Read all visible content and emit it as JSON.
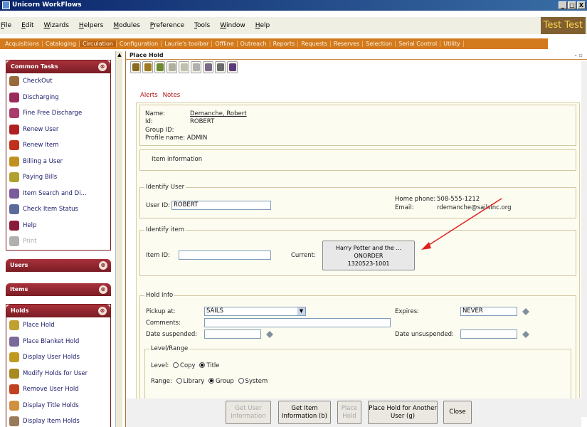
{
  "window": {
    "title": "Unicorn WorkFlows",
    "controls": [
      "_",
      "□",
      "X"
    ]
  },
  "menubar": {
    "items": [
      "File",
      "Edit",
      "Wizards",
      "Helpers",
      "Modules",
      "Preference",
      "Tools",
      "Window",
      "Help"
    ],
    "user_label": "Test Test"
  },
  "modules": [
    "Acquisitions",
    "Cataloging",
    "Circulation",
    "Configuration",
    "Laurie's toolbar",
    "Offline",
    "Outreach",
    "Reports",
    "Requests",
    "Reserves",
    "Selection",
    "Serial Control",
    "Utility"
  ],
  "left_panel": {
    "common_tasks": {
      "title": "Common Tasks",
      "items": [
        {
          "label": "CheckOut",
          "icon": "checkout-icon",
          "color": "#9a6b3a"
        },
        {
          "label": "Discharging",
          "icon": "discharge-icon",
          "color": "#9b2b5a"
        },
        {
          "label": "Fine Free Discharge",
          "icon": "fine-free-icon",
          "color": "#a83c6c"
        },
        {
          "label": "Renew User",
          "icon": "renew-user-icon",
          "color": "#b02020"
        },
        {
          "label": "Renew Item",
          "icon": "renew-item-icon",
          "color": "#c0301a"
        },
        {
          "label": "Billing a User",
          "icon": "billing-icon",
          "color": "#c09020"
        },
        {
          "label": "Paying Bills",
          "icon": "paying-bills-icon",
          "color": "#b0a030"
        },
        {
          "label": "Item Search and Di...",
          "icon": "item-search-icon",
          "color": "#7a5a9a"
        },
        {
          "label": "Check Item Status",
          "icon": "item-status-icon",
          "color": "#5a6a9a"
        },
        {
          "label": "Help",
          "icon": "help-icon",
          "color": "#8a1c3a"
        },
        {
          "label": "Print",
          "icon": "print-icon",
          "color": "#b0b0b0"
        }
      ]
    },
    "users": {
      "title": "Users"
    },
    "items": {
      "title": "Items"
    },
    "holds": {
      "title": "Holds",
      "items": [
        {
          "label": "Place Hold",
          "icon": "place-hold-icon",
          "color": "#c0a030"
        },
        {
          "label": "Place Blanket Hold",
          "icon": "blanket-hold-icon",
          "color": "#7a6a9a"
        },
        {
          "label": "Display User Holds",
          "icon": "display-user-holds-icon",
          "color": "#c09a20"
        },
        {
          "label": "Modify Holds for User",
          "icon": "modify-holds-icon",
          "color": "#a88a20"
        },
        {
          "label": "Remove User Hold",
          "icon": "remove-hold-icon",
          "color": "#c04020"
        },
        {
          "label": "Display Title Holds",
          "icon": "title-holds-icon",
          "color": "#d09040"
        },
        {
          "label": "Display Item Holds",
          "icon": "item-holds-icon",
          "color": "#9a7a5a"
        }
      ]
    },
    "collapse_glyph": "⊗"
  },
  "main": {
    "title": "Place Hold",
    "window_controls": "- ▫",
    "toolbar_icons": [
      {
        "name": "user-search-icon",
        "color": "#8a6a20"
      },
      {
        "name": "user-info-icon",
        "color": "#a07a20"
      },
      {
        "name": "display-user-icon",
        "color": "#6a8a30"
      },
      {
        "name": "item-info-icon",
        "color": "#b0b0a0"
      },
      {
        "name": "place-hold-tool-icon",
        "color": "#c0c0b0"
      },
      {
        "name": "hold-list-icon",
        "color": "#b0b0b0"
      },
      {
        "name": "modify-icon",
        "color": "#7a6a8a"
      },
      {
        "name": "search-item-icon",
        "color": "#6a6a6a"
      },
      {
        "name": "barcode-icon",
        "color": "#5a3a7a"
      }
    ],
    "tabs": [
      "Alerts",
      "Notes"
    ],
    "user_info": {
      "name_label": "Name:",
      "name_value": "Demanche, Robert",
      "id_label": "Id:",
      "id_value": "ROBERT",
      "group_label": "Group ID:",
      "profile_label": "Profile name: ADMIN"
    },
    "item_information_label": "Item information",
    "identify_user": {
      "title": "Identify User",
      "user_id_label": "User ID:",
      "user_id_value": "ROBERT",
      "home_phone_label": "Home phone:",
      "home_phone_value": "508-555-1212",
      "email_label": "Email:",
      "email_value": "rdemanche@sailsinc.org"
    },
    "identify_item": {
      "title": "Identify item",
      "item_id_label": "Item ID:",
      "item_id_value": "",
      "current_label": "Current:",
      "current_line1": "Harry Potter and the ...",
      "current_line2": "ONORDER",
      "current_line3": "1320523-1001"
    },
    "hold_info": {
      "title": "Hold Info",
      "pickup_label": "Pickup at:",
      "pickup_value": "SAILS",
      "expires_label": "Expires:",
      "expires_value": "NEVER",
      "comments_label": "Comments:",
      "date_suspended_label": "Date suspended:",
      "date_unsuspended_label": "Date unsuspended:",
      "level_range_title": "Level/Range",
      "level_label": "Level:",
      "level_options": [
        "Copy",
        "Title"
      ],
      "level_selected": "Title",
      "range_label": "Range:",
      "range_options": [
        "Library",
        "Group",
        "System"
      ],
      "range_selected": "Group"
    },
    "buttons": {
      "get_user": "Get User Information",
      "get_item": "Get Item Information (b)",
      "place_hold": "Place Hold",
      "place_hold_another": "Place Hold for Another User (g)",
      "close": "Close"
    }
  },
  "annotation": {
    "arrow_color": "#e02020"
  }
}
